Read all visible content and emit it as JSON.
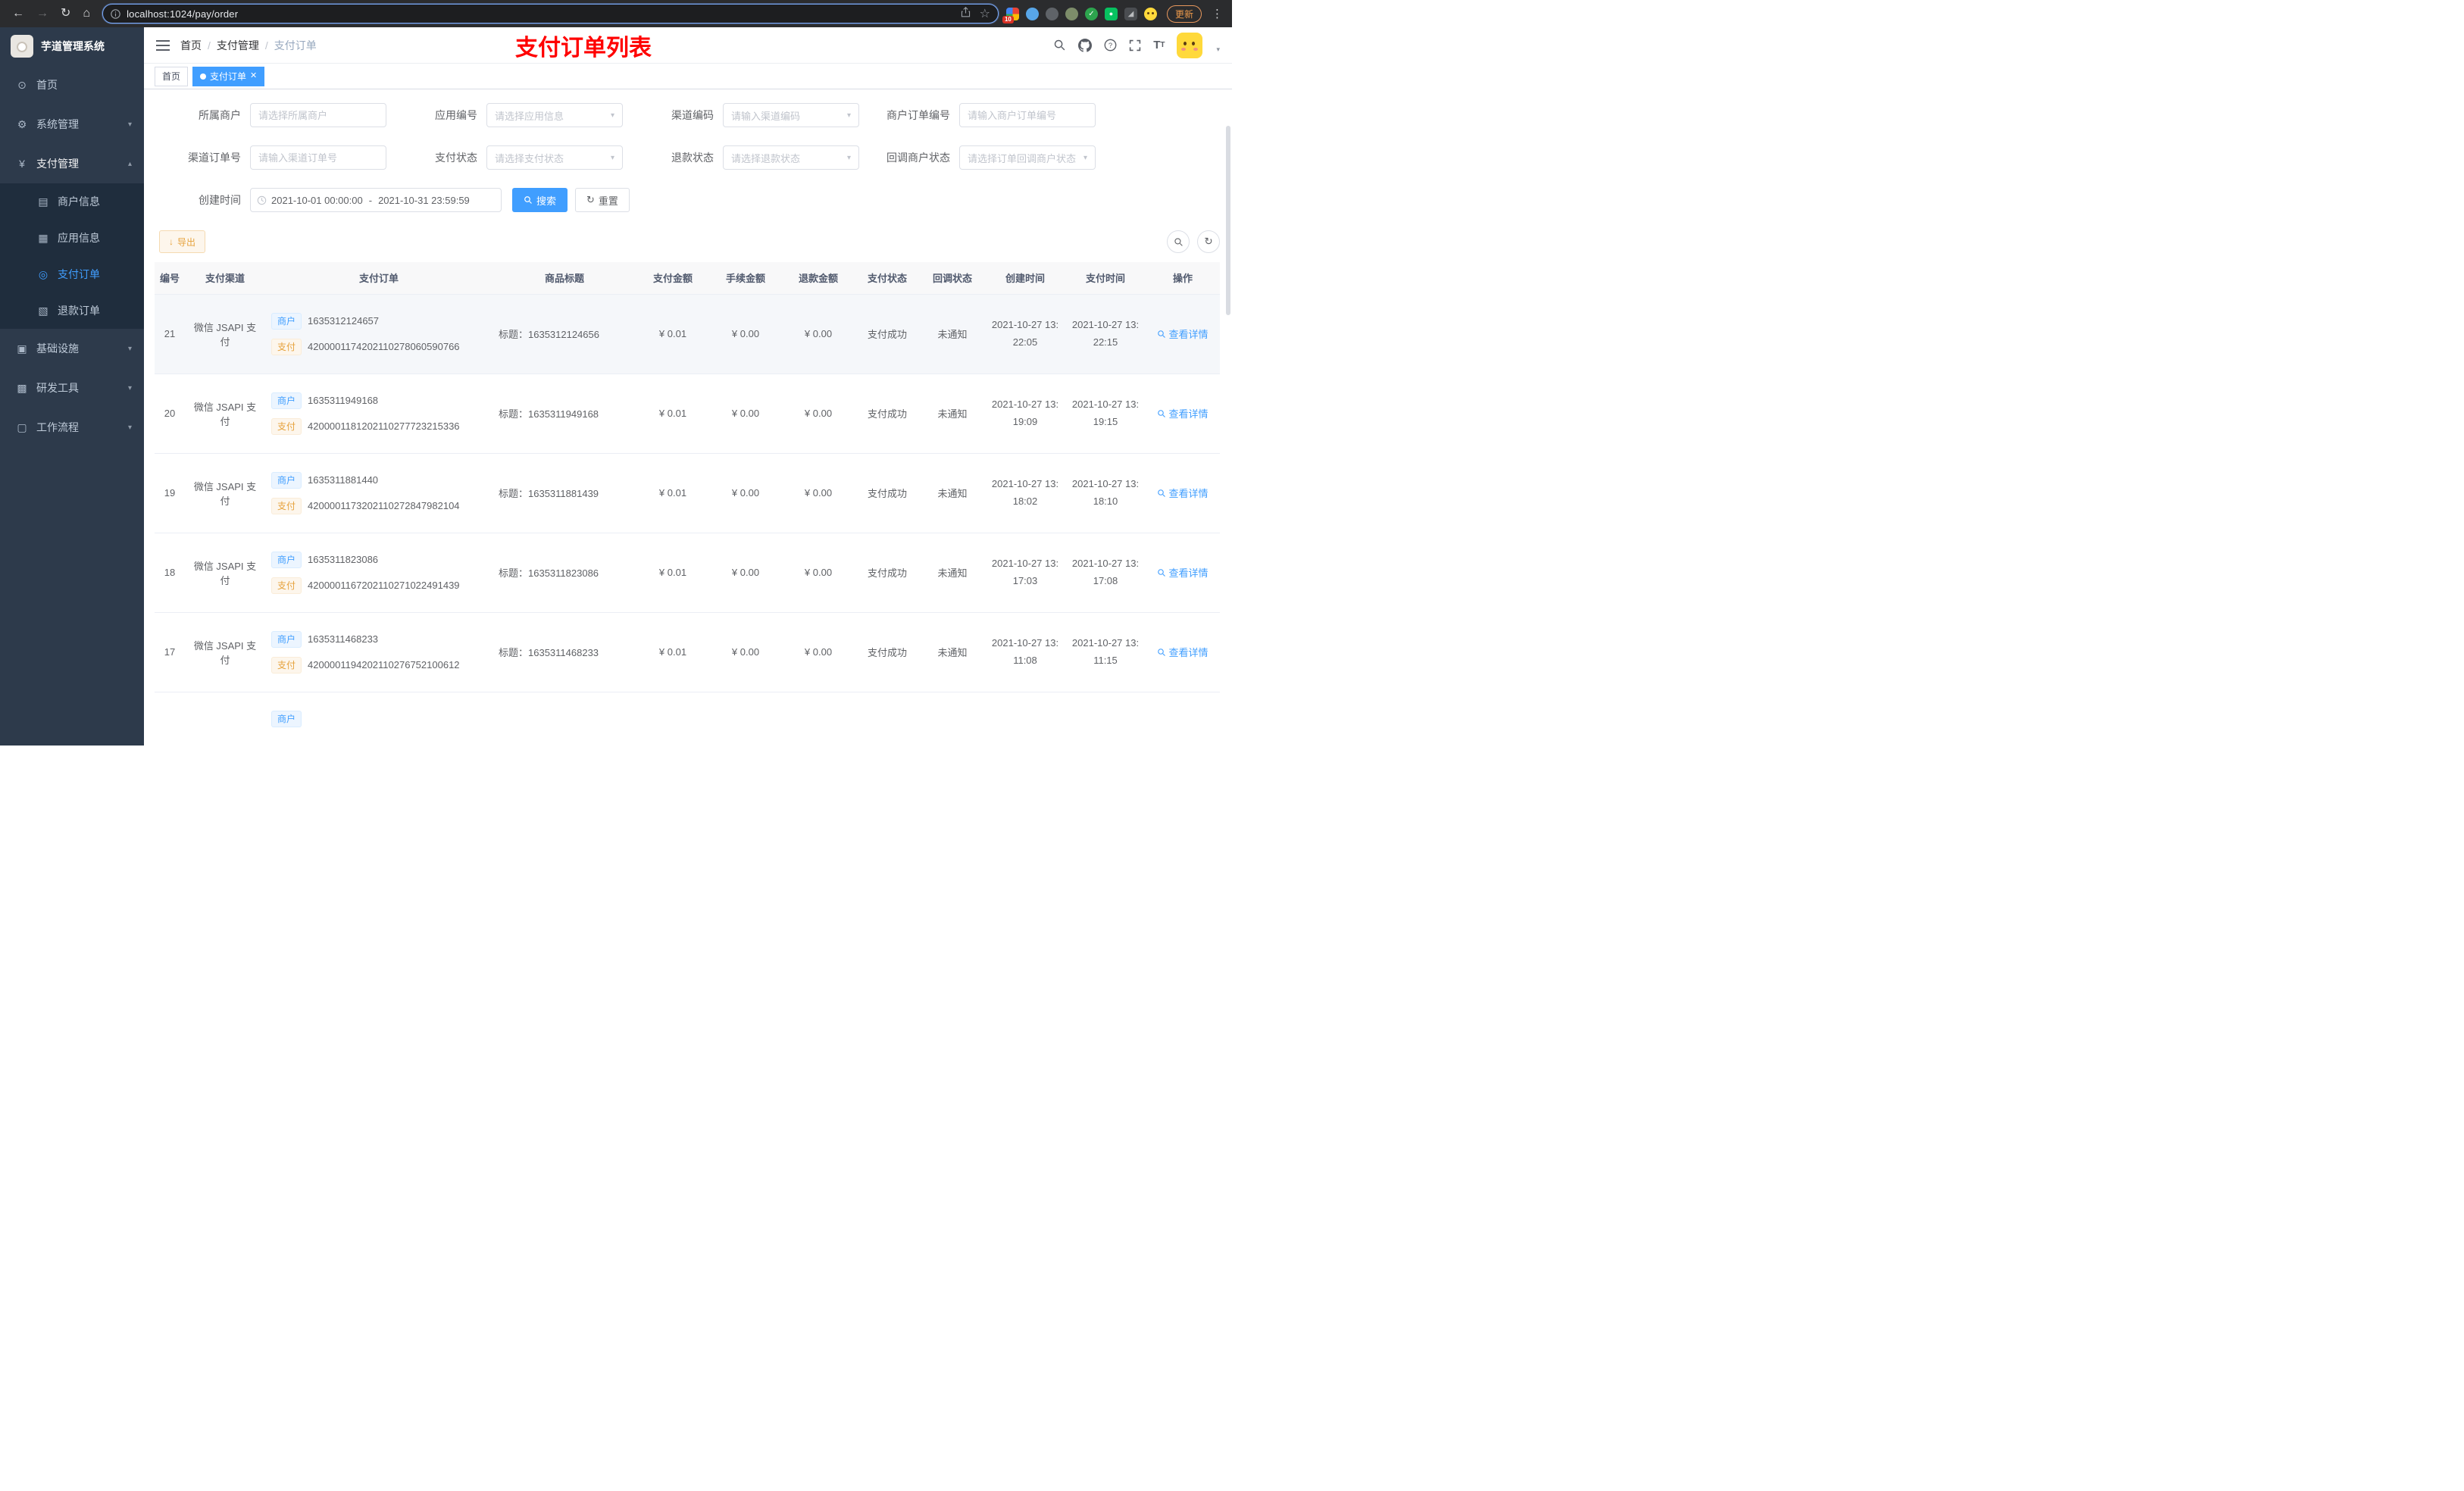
{
  "theme": {
    "accent": "#409eff",
    "warning": "#e6a23c",
    "danger": "#ff0000",
    "sidebar": "#2d3a4b",
    "submenu": "#1f2d3d"
  },
  "browser": {
    "url": "localhost:1024/pay/order",
    "extension_badge": "10",
    "update_label": "更新"
  },
  "sidebar": {
    "logo_title": "芋道管理系统",
    "menu": [
      {
        "label": "首页"
      },
      {
        "label": "系统管理"
      },
      {
        "label": "支付管理"
      },
      {
        "label": "商户信息"
      },
      {
        "label": "应用信息"
      },
      {
        "label": "支付订单"
      },
      {
        "label": "退款订单"
      },
      {
        "label": "基础设施"
      },
      {
        "label": "研发工具"
      },
      {
        "label": "工作流程"
      }
    ]
  },
  "header": {
    "breadcrumb": [
      "首页",
      "支付管理",
      "支付订单"
    ],
    "breadcrumb_separator": "/",
    "annotation": "支付订单列表"
  },
  "tags_view": {
    "tabs": [
      {
        "label": "首页"
      },
      {
        "label": "支付订单"
      }
    ]
  },
  "filters": {
    "fields": [
      {
        "label": "所属商户",
        "placeholder": "请选择所属商户"
      },
      {
        "label": "应用编号",
        "placeholder": "请选择应用信息"
      },
      {
        "label": "渠道编码",
        "placeholder": "请输入渠道编码"
      },
      {
        "label": "商户订单编号",
        "placeholder": "请输入商户订单编号"
      },
      {
        "label": "渠道订单号",
        "placeholder": "请输入渠道订单号"
      },
      {
        "label": "支付状态",
        "placeholder": "请选择支付状态"
      },
      {
        "label": "退款状态",
        "placeholder": "请选择退款状态"
      },
      {
        "label": "回调商户状态",
        "placeholder": "请选择订单回调商户状态"
      }
    ],
    "create_time": {
      "label": "创建时间",
      "start": "2021-10-01 00:00:00",
      "separator": "-",
      "end": "2021-10-31 23:59:59"
    },
    "search_label": "搜索",
    "reset_label": "重置"
  },
  "toolbar": {
    "export_label": "导出"
  },
  "table": {
    "columns": [
      "编号",
      "支付渠道",
      "支付订单",
      "商品标题",
      "支付金额",
      "手续金额",
      "退款金额",
      "支付状态",
      "回调状态",
      "创建时间",
      "支付时间",
      "操作"
    ],
    "merchant_tag": "商户",
    "pay_tag": "支付",
    "rows": [
      {
        "id": "21",
        "channel": "微信 JSAPI 支付",
        "merchant_no": "1635312124657",
        "pay_no": "4200001174202110278060590766",
        "title": "标题：1635312124656",
        "amount": "¥ 0.01",
        "fee": "¥ 0.00",
        "refund": "¥ 0.00",
        "status": "支付成功",
        "notify_status": "未通知",
        "create_time": "2021-10-27 13:22:05",
        "pay_time": "2021-10-27 13:22:15",
        "action": "查看详情"
      },
      {
        "id": "20",
        "channel": "微信 JSAPI 支付",
        "merchant_no": "1635311949168",
        "pay_no": "4200001181202110277723215336",
        "title": "标题：1635311949168",
        "amount": "¥ 0.01",
        "fee": "¥ 0.00",
        "refund": "¥ 0.00",
        "status": "支付成功",
        "notify_status": "未通知",
        "create_time": "2021-10-27 13:19:09",
        "pay_time": "2021-10-27 13:19:15",
        "action": "查看详情"
      },
      {
        "id": "19",
        "channel": "微信 JSAPI 支付",
        "merchant_no": "1635311881440",
        "pay_no": "4200001173202110272847982104",
        "title": "标题：1635311881439",
        "amount": "¥ 0.01",
        "fee": "¥ 0.00",
        "refund": "¥ 0.00",
        "status": "支付成功",
        "notify_status": "未通知",
        "create_time": "2021-10-27 13:18:02",
        "pay_time": "2021-10-27 13:18:10",
        "action": "查看详情"
      },
      {
        "id": "18",
        "channel": "微信 JSAPI 支付",
        "merchant_no": "1635311823086",
        "pay_no": "4200001167202110271022491439",
        "title": "标题：1635311823086",
        "amount": "¥ 0.01",
        "fee": "¥ 0.00",
        "refund": "¥ 0.00",
        "status": "支付成功",
        "notify_status": "未通知",
        "create_time": "2021-10-27 13:17:03",
        "pay_time": "2021-10-27 13:17:08",
        "action": "查看详情"
      },
      {
        "id": "17",
        "channel": "微信 JSAPI 支付",
        "merchant_no": "1635311468233",
        "pay_no": "4200001194202110276752100612",
        "title": "标题：1635311468233",
        "amount": "¥ 0.01",
        "fee": "¥ 0.00",
        "refund": "¥ 0.00",
        "status": "支付成功",
        "notify_status": "未通知",
        "create_time": "2021-10-27 13:11:08",
        "pay_time": "2021-10-27 13:11:15",
        "action": "查看详情"
      }
    ]
  }
}
